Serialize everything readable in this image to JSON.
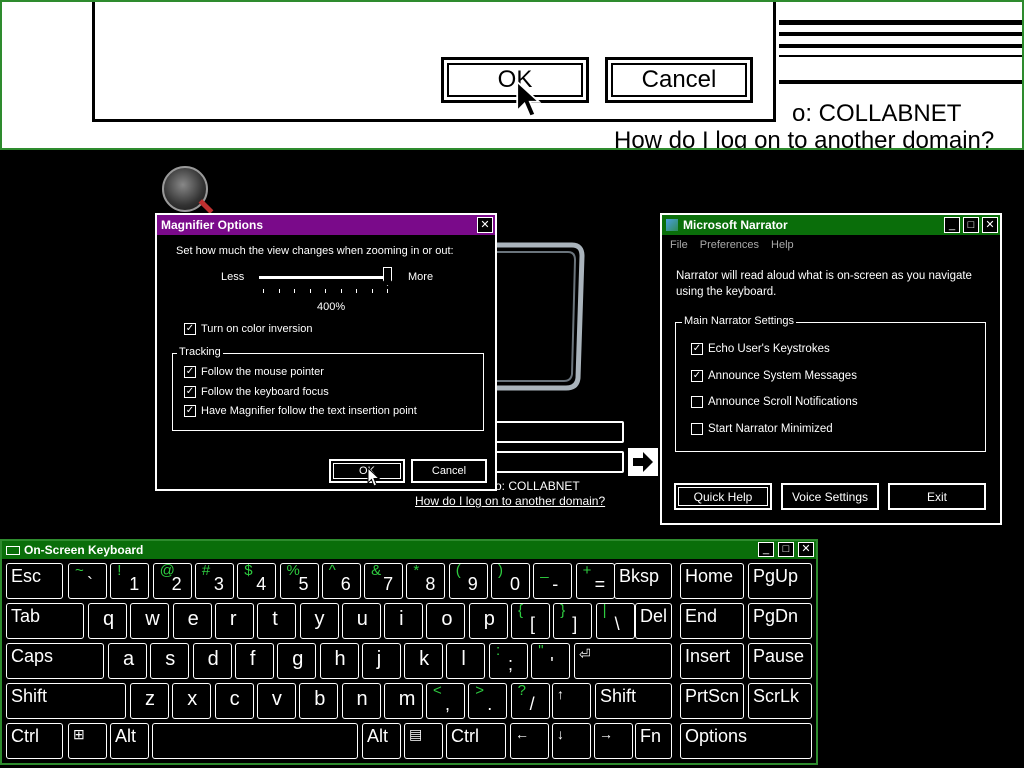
{
  "magnified": {
    "ok_label": "OK",
    "cancel_label": "Cancel",
    "domain_text": "o: COLLABNET",
    "domain_link": "How do I log on to another domain?"
  },
  "magnifier_options": {
    "title": "Magnifier Options",
    "instruction": "Set how much the view changes when zooming in or out:",
    "less_label": "Less",
    "more_label": "More",
    "zoom_value": "400%",
    "zoom_fraction": 1.0,
    "color_inversion_label": "Turn on color inversion",
    "color_inversion_checked": true,
    "tracking_label": "Tracking",
    "tracking": [
      {
        "label": "Follow the mouse pointer",
        "checked": true
      },
      {
        "label": "Follow the keyboard focus",
        "checked": true
      },
      {
        "label": "Have Magnifier follow the text insertion point",
        "checked": true
      }
    ],
    "ok_label": "OK",
    "cancel_label": "Cancel"
  },
  "login": {
    "domain_text": "o: COLLABNET",
    "domain_link": "How do I log on to another domain?"
  },
  "narrator": {
    "title": "Microsoft Narrator",
    "menu": [
      "File",
      "Preferences",
      "Help"
    ],
    "description": "Narrator will read aloud what is on-screen as you navigate using the keyboard.",
    "settings_label": "Main Narrator Settings",
    "settings": [
      {
        "label": "Echo User's Keystrokes",
        "checked": true
      },
      {
        "label": "Announce System Messages",
        "checked": true
      },
      {
        "label": "Announce Scroll Notifications",
        "checked": false
      },
      {
        "label": "Start Narrator Minimized",
        "checked": false
      }
    ],
    "quick_help_label": "Quick Help",
    "voice_settings_label": "Voice Settings",
    "exit_label": "Exit"
  },
  "keyboard": {
    "title": "On-Screen Keyboard",
    "keys": {
      "esc": "Esc",
      "bksp": "Bksp",
      "home": "Home",
      "pgup": "PgUp",
      "tab": "Tab",
      "del": "Del",
      "end": "End",
      "pgdn": "PgDn",
      "caps": "Caps",
      "insert": "Insert",
      "pause": "Pause",
      "shift": "Shift",
      "prtscn": "PrtScn",
      "scrlk": "ScrLk",
      "ctrl": "Ctrl",
      "alt": "Alt",
      "fn": "Fn",
      "options": "Options"
    },
    "row1": [
      [
        "~",
        "`"
      ],
      [
        "!",
        "1"
      ],
      [
        "@",
        "2"
      ],
      [
        "#",
        "3"
      ],
      [
        "$",
        "4"
      ],
      [
        "%",
        "5"
      ],
      [
        "^",
        "6"
      ],
      [
        "&",
        "7"
      ],
      [
        "*",
        "8"
      ],
      [
        "(",
        "9"
      ],
      [
        ")",
        "0"
      ],
      [
        "_",
        "-"
      ],
      [
        "+",
        "="
      ]
    ],
    "row2": [
      "q",
      "w",
      "e",
      "r",
      "t",
      "y",
      "u",
      "i",
      "o",
      "p"
    ],
    "row2_sym": [
      [
        "{",
        "["
      ],
      [
        "}",
        "]"
      ],
      [
        "|",
        "\\"
      ]
    ],
    "row3": [
      "a",
      "s",
      "d",
      "f",
      "g",
      "h",
      "j",
      "k",
      "l"
    ],
    "row3_sym": [
      [
        ":",
        ";"
      ],
      [
        "\"",
        "'"
      ]
    ],
    "row4": [
      "z",
      "x",
      "c",
      "v",
      "b",
      "n",
      "m"
    ],
    "row4_sym": [
      [
        "<",
        ","
      ],
      [
        ">",
        "."
      ],
      [
        "?",
        "/"
      ]
    ],
    "arrows": {
      "up": "↑",
      "down": "↓",
      "left": "←",
      "right": "→"
    }
  }
}
